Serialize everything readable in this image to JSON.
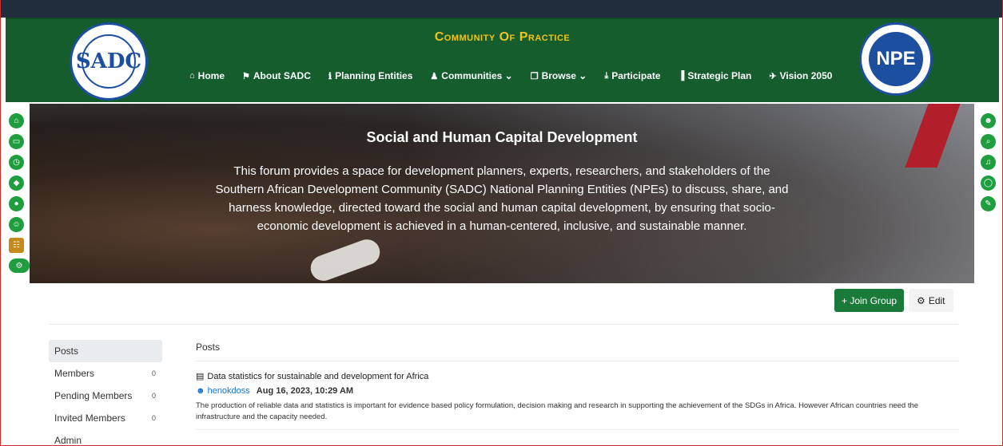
{
  "site": {
    "title": "Community Of Practice",
    "logo_left_text": "SADC",
    "logo_right_text": "NPE"
  },
  "nav": [
    {
      "label": "Home",
      "icon": "⌂"
    },
    {
      "label": "About SADC",
      "icon": "⚑"
    },
    {
      "label": "Planning Entities",
      "icon": "ℹ"
    },
    {
      "label": "Communities ⌄",
      "icon": "♟"
    },
    {
      "label": "Browse ⌄",
      "icon": "❐"
    },
    {
      "label": "Participate",
      "icon": "⤓"
    },
    {
      "label": "Strategic Plan",
      "icon": "▐"
    },
    {
      "label": "Vision 2050",
      "icon": "✈"
    }
  ],
  "hero": {
    "title": "Social and Human Capital Development",
    "description": "This forum provides a space for development planners, experts, researchers, and stakeholders of the Southern African Development Community (SADC) National Planning Entities (NPEs) to discuss, share, and harness knowledge, directed toward the social and human capital development, by ensuring that socio-economic development is achieved in a human-centered, inclusive, and sustainable manner."
  },
  "sidebar_left_icons": [
    "home-icon",
    "inbox-icon",
    "clock-icon",
    "tags-icon",
    "fire-icon",
    "user-icon",
    "groups-icon",
    "cogs-icon"
  ],
  "sidebar_right_icons": [
    "profile-icon",
    "search-icon",
    "bell-icon",
    "chat-icon",
    "compose-icon"
  ],
  "actions": {
    "join_label": "+ Join Group",
    "edit_label": "Edit",
    "accent": "#1a7a3a"
  },
  "menu": [
    {
      "label": "Posts",
      "count": ""
    },
    {
      "label": "Members",
      "count": "0"
    },
    {
      "label": "Pending Members",
      "count": "0"
    },
    {
      "label": "Invited Members",
      "count": "0"
    },
    {
      "label": "Admin",
      "count": ""
    }
  ],
  "content": {
    "header": "Posts",
    "posts": [
      {
        "title": "Data statistics for sustainable and development for Africa",
        "author": "henokdoss",
        "date": "Aug 16, 2023, 10:29 AM",
        "excerpt": "The production of reliable data and statistics is important for evidence based policy formulation, decision making and research in supporting the achievement of the SDGs in Africa. However African countries need the infrastructure and the capacity needed."
      }
    ]
  },
  "colors": {
    "header_green": "#155d2d",
    "title_gold": "#f2c318",
    "icon_green": "#1e9e3e"
  }
}
